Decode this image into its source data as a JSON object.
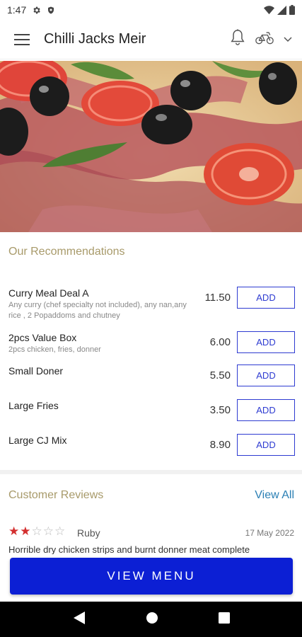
{
  "status_bar": {
    "time": "1:47"
  },
  "app_bar": {
    "title": "Chilli Jacks Meir"
  },
  "recommendations": {
    "title": "Our Recommendations",
    "items": [
      {
        "name": "Curry Meal Deal A",
        "description": "Any curry (chef specialty not included), any nan,any rice , 2 Popaddoms and chutney",
        "price": "11.50",
        "button": "ADD"
      },
      {
        "name": "2pcs Value Box",
        "description": "2pcs chicken, fries, donner",
        "price": "6.00",
        "button": "ADD"
      },
      {
        "name": "Small Doner",
        "description": "",
        "price": "5.50",
        "button": "ADD"
      },
      {
        "name": "Large Fries",
        "description": "",
        "price": "3.50",
        "button": "ADD"
      },
      {
        "name": "Large CJ Mix",
        "description": "",
        "price": "8.90",
        "button": "ADD"
      }
    ]
  },
  "reviews": {
    "title": "Customer Reviews",
    "view_all": "View All",
    "items": [
      {
        "rating": 2,
        "max_rating": 5,
        "reviewer": "Ruby",
        "date": "17 May 2022",
        "text": "Horrible dry chicken strips and burnt donner meat complete"
      }
    ]
  },
  "cta": {
    "label": "VIEW MENU"
  },
  "colors": {
    "accent": "#0c1fd4",
    "add_button": "#2e3bd1",
    "section_title": "#a89a6a",
    "link": "#2a7fb4",
    "star": "#d32f2f"
  },
  "icons": [
    "settings-icon",
    "shield-icon",
    "wifi-icon",
    "signal-icon",
    "battery-icon",
    "menu-icon",
    "bell-icon",
    "cycle-icon",
    "chevron-down-icon",
    "back-icon",
    "home-icon",
    "recents-icon"
  ]
}
